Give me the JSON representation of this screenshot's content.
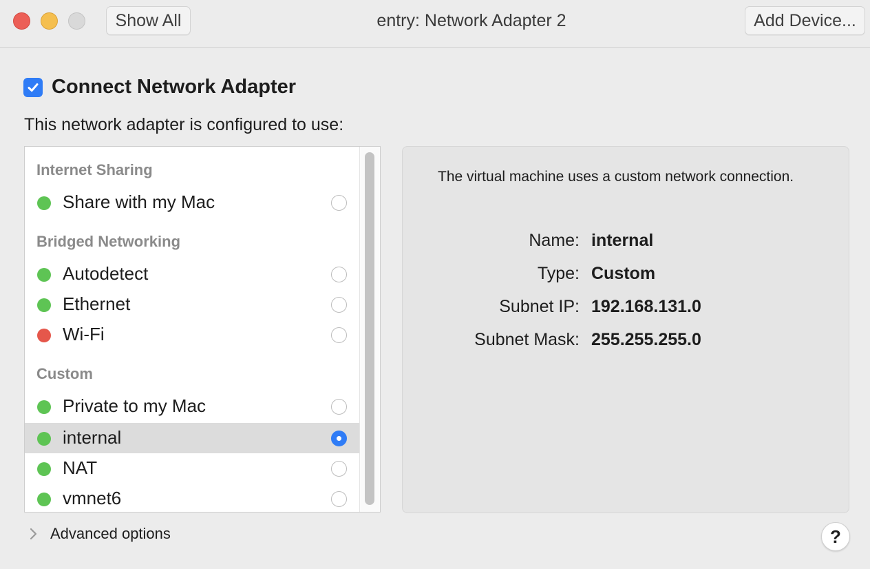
{
  "window": {
    "title": "entry: Network Adapter 2",
    "show_all_label": "Show All",
    "add_device_label": "Add Device..."
  },
  "connect": {
    "label": "Connect Network Adapter",
    "checked": true
  },
  "configured_label": "This network adapter is configured to use:",
  "network_list": {
    "sections": [
      {
        "header": "Internet Sharing",
        "items": [
          {
            "label": "Share with my Mac",
            "status": "green",
            "selected": false
          }
        ]
      },
      {
        "header": "Bridged Networking",
        "items": [
          {
            "label": "Autodetect",
            "status": "green",
            "selected": false
          },
          {
            "label": "Ethernet",
            "status": "green",
            "selected": false
          },
          {
            "label": "Wi-Fi",
            "status": "red",
            "selected": false
          }
        ]
      },
      {
        "header": "Custom",
        "items": [
          {
            "label": "Private to my Mac",
            "status": "green",
            "selected": false
          },
          {
            "label": "internal",
            "status": "green",
            "selected": true
          },
          {
            "label": "NAT",
            "status": "green",
            "selected": false
          },
          {
            "label": "vmnet6",
            "status": "green",
            "selected": false
          }
        ]
      }
    ]
  },
  "details": {
    "description": "The virtual machine uses a custom network connection.",
    "fields": [
      {
        "key": "Name:",
        "value": "internal"
      },
      {
        "key": "Type:",
        "value": "Custom"
      },
      {
        "key": "Subnet IP:",
        "value": "192.168.131.0"
      },
      {
        "key": "Subnet Mask:",
        "value": "255.255.255.0"
      }
    ]
  },
  "advanced_label": "Advanced options",
  "help_label": "?",
  "colors": {
    "accent": "#2f7cf6",
    "status_green": "#5ec454",
    "status_red": "#e5574b",
    "close": "#ec5f57",
    "minimize": "#f5bf4f",
    "zoom_disabled": "#d9d9d9"
  },
  "icons": {
    "checkbox": "checkmark-icon",
    "advanced": "chevron-right-icon",
    "help": "question-mark-icon"
  }
}
